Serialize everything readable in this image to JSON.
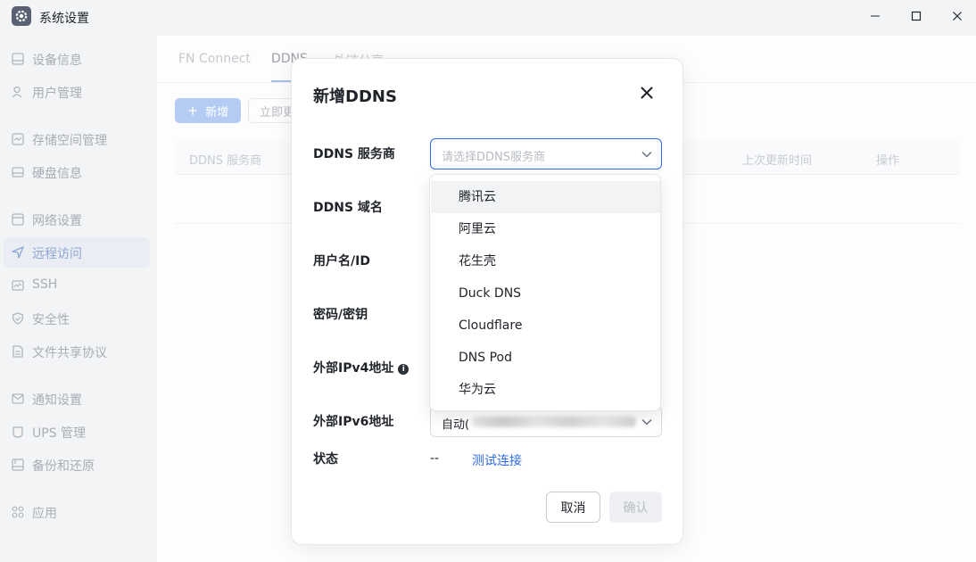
{
  "window": {
    "title": "系统设置"
  },
  "sidebar": {
    "items": [
      {
        "label": "设备信息",
        "icon": "device-info-icon"
      },
      {
        "label": "用户管理",
        "icon": "user-icon"
      },
      {
        "label": "存储空间管理",
        "icon": "storage-icon"
      },
      {
        "label": "硬盘信息",
        "icon": "disk-icon"
      },
      {
        "label": "网络设置",
        "icon": "network-icon"
      },
      {
        "label": "远程访问",
        "icon": "send-icon",
        "active": true
      },
      {
        "label": "SSH",
        "icon": "terminal-icon"
      },
      {
        "label": "安全性",
        "icon": "shield-icon"
      },
      {
        "label": "文件共享协议",
        "icon": "file-icon"
      },
      {
        "label": "通知设置",
        "icon": "mail-icon"
      },
      {
        "label": "UPS 管理",
        "icon": "ups-icon"
      },
      {
        "label": "备份和还原",
        "icon": "backup-icon"
      },
      {
        "label": "应用",
        "icon": "apps-icon"
      }
    ]
  },
  "main": {
    "tabs": [
      {
        "label": "FN Connect"
      },
      {
        "label": "DDNS",
        "active": true
      },
      {
        "label": "外链分享"
      }
    ],
    "new_button": "新增",
    "refresh_button": "立即更新",
    "table_headers": {
      "provider": "DDNS 服务商",
      "last_update": "上次更新时间",
      "actions": "操作"
    }
  },
  "modal": {
    "title": "新增DDNS",
    "fields": {
      "provider_label": "DDNS 服务商",
      "provider_placeholder": "请选择DDNS服务商",
      "domain_label": "DDNS 域名",
      "username_label": "用户名/ID",
      "password_label": "密码/密钥",
      "ipv4_label": "外部IPv4地址",
      "ipv6_label": "外部IPv6地址",
      "ipv6_value": "自动(",
      "status_label": "状态",
      "status_value": "--",
      "test_link": "测试连接"
    },
    "cancel_button": "取消",
    "confirm_button": "确认"
  },
  "dropdown": {
    "options": [
      "腾讯云",
      "阿里云",
      "花生壳",
      "Duck DNS",
      "Cloudflare",
      "DNS Pod",
      "华为云"
    ],
    "hovered_index": 0
  },
  "colors": {
    "accent": "#2e6be6",
    "sidebar_bg": "#f3f4f6",
    "active_nav_bg": "#eaedf3"
  }
}
